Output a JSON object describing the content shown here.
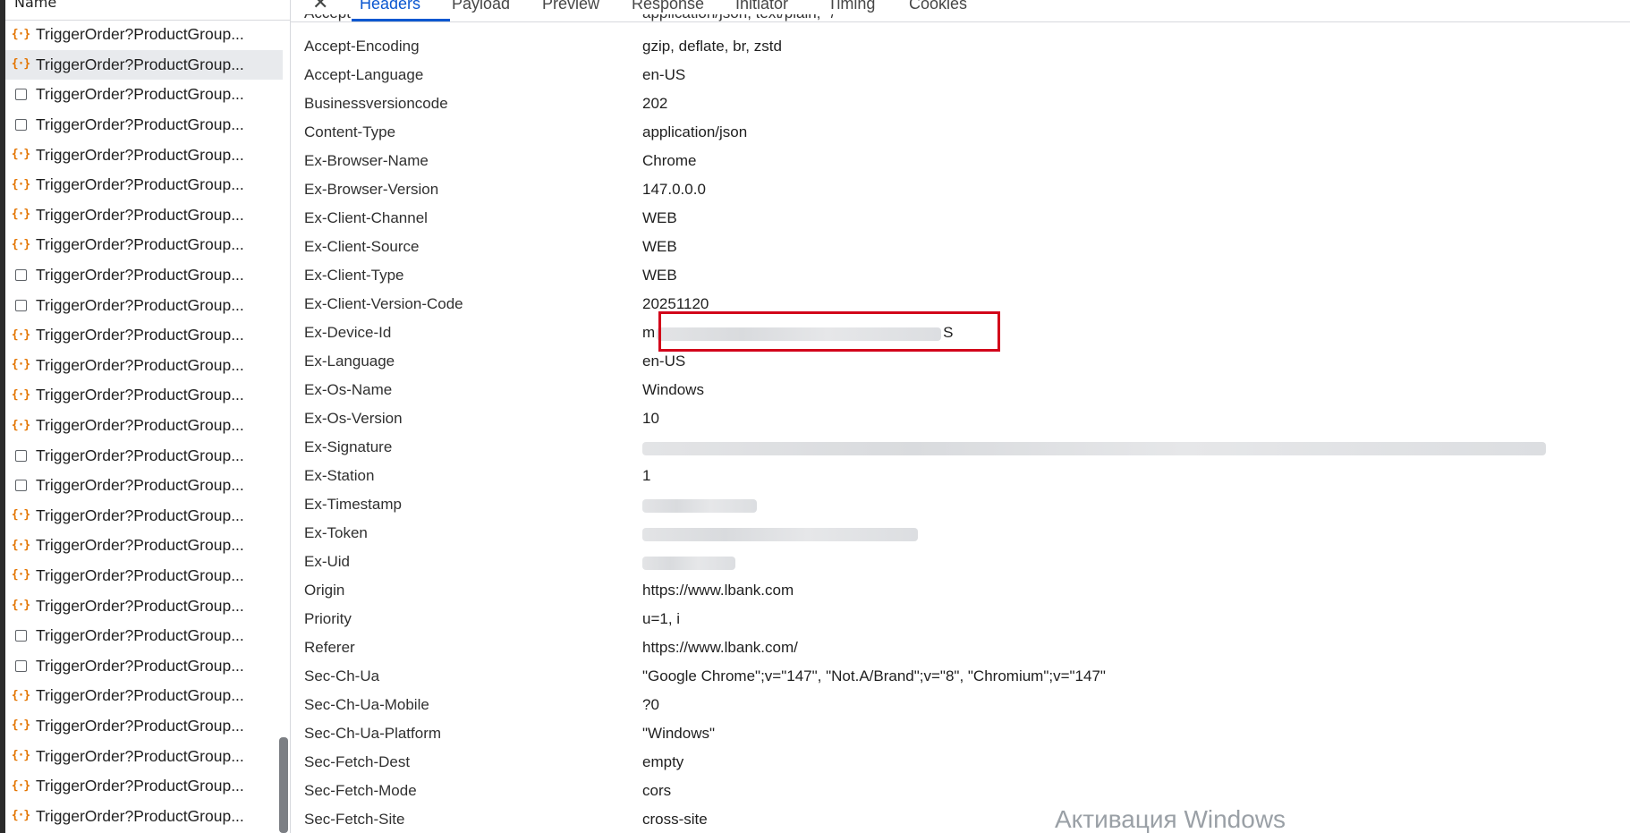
{
  "request_list": {
    "column_name": "Name",
    "rows": [
      {
        "label": "TriggerOrder?ProductGroup...",
        "icon": "xhr-braces-icon",
        "selected": false
      },
      {
        "label": "TriggerOrder?ProductGroup...",
        "icon": "xhr-braces-icon",
        "selected": true
      },
      {
        "label": "TriggerOrder?ProductGroup...",
        "icon": "document-icon",
        "selected": false
      },
      {
        "label": "TriggerOrder?ProductGroup...",
        "icon": "document-icon",
        "selected": false
      },
      {
        "label": "TriggerOrder?ProductGroup...",
        "icon": "xhr-braces-icon",
        "selected": false
      },
      {
        "label": "TriggerOrder?ProductGroup...",
        "icon": "xhr-braces-icon",
        "selected": false
      },
      {
        "label": "TriggerOrder?ProductGroup...",
        "icon": "xhr-braces-icon",
        "selected": false
      },
      {
        "label": "TriggerOrder?ProductGroup...",
        "icon": "xhr-braces-icon",
        "selected": false
      },
      {
        "label": "TriggerOrder?ProductGroup...",
        "icon": "document-icon",
        "selected": false
      },
      {
        "label": "TriggerOrder?ProductGroup...",
        "icon": "document-icon",
        "selected": false
      },
      {
        "label": "TriggerOrder?ProductGroup...",
        "icon": "xhr-braces-icon",
        "selected": false
      },
      {
        "label": "TriggerOrder?ProductGroup...",
        "icon": "xhr-braces-icon",
        "selected": false
      },
      {
        "label": "TriggerOrder?ProductGroup...",
        "icon": "xhr-braces-icon",
        "selected": false
      },
      {
        "label": "TriggerOrder?ProductGroup...",
        "icon": "xhr-braces-icon",
        "selected": false
      },
      {
        "label": "TriggerOrder?ProductGroup...",
        "icon": "document-icon",
        "selected": false
      },
      {
        "label": "TriggerOrder?ProductGroup...",
        "icon": "document-icon",
        "selected": false
      },
      {
        "label": "TriggerOrder?ProductGroup...",
        "icon": "xhr-braces-icon",
        "selected": false
      },
      {
        "label": "TriggerOrder?ProductGroup...",
        "icon": "xhr-braces-icon",
        "selected": false
      },
      {
        "label": "TriggerOrder?ProductGroup...",
        "icon": "xhr-braces-icon",
        "selected": false
      },
      {
        "label": "TriggerOrder?ProductGroup...",
        "icon": "xhr-braces-icon",
        "selected": false
      },
      {
        "label": "TriggerOrder?ProductGroup...",
        "icon": "document-icon",
        "selected": false
      },
      {
        "label": "TriggerOrder?ProductGroup...",
        "icon": "document-icon",
        "selected": false
      },
      {
        "label": "TriggerOrder?ProductGroup...",
        "icon": "xhr-braces-icon",
        "selected": false
      },
      {
        "label": "TriggerOrder?ProductGroup...",
        "icon": "xhr-braces-icon",
        "selected": false
      },
      {
        "label": "TriggerOrder?ProductGroup...",
        "icon": "xhr-braces-icon",
        "selected": false
      },
      {
        "label": "TriggerOrder?ProductGroup...",
        "icon": "xhr-braces-icon",
        "selected": false
      },
      {
        "label": "TriggerOrder?ProductGroup...",
        "icon": "xhr-braces-icon",
        "selected": false
      }
    ]
  },
  "tabs": {
    "close_label": "✕",
    "items": [
      {
        "label": "Headers",
        "active": true
      },
      {
        "label": "Payload",
        "active": false
      },
      {
        "label": "Preview",
        "active": false
      },
      {
        "label": "Response",
        "active": false
      },
      {
        "label": "Initiator",
        "active": false
      },
      {
        "label": "Timing",
        "active": false
      },
      {
        "label": "Cookies",
        "active": false
      }
    ]
  },
  "headers": {
    "clipped_top": {
      "name": "Accept",
      "value": "application/json, text/plain, */*"
    },
    "rows": [
      {
        "name": "Accept-Encoding",
        "value": "gzip, deflate, br, zstd"
      },
      {
        "name": "Accept-Language",
        "value": "en-US"
      },
      {
        "name": "Businessversioncode",
        "value": "202"
      },
      {
        "name": "Content-Type",
        "value": "application/json"
      },
      {
        "name": "Ex-Browser-Name",
        "value": "Chrome"
      },
      {
        "name": "Ex-Browser-Version",
        "value": "147.0.0.0"
      },
      {
        "name": "Ex-Client-Channel",
        "value": "WEB"
      },
      {
        "name": "Ex-Client-Source",
        "value": "WEB"
      },
      {
        "name": "Ex-Client-Type",
        "value": "WEB"
      },
      {
        "name": "Ex-Client-Version-Code",
        "value": "20251120"
      },
      {
        "name": "Ex-Device-Id",
        "value_prefix": "m",
        "value_suffix": "S",
        "redacted": true
      },
      {
        "name": "Ex-Language",
        "value": "en-US"
      },
      {
        "name": "Ex-Os-Name",
        "value": "Windows"
      },
      {
        "name": "Ex-Os-Version",
        "value": "10"
      },
      {
        "name": "Ex-Signature",
        "redacted": true
      },
      {
        "name": "Ex-Station",
        "value": "1"
      },
      {
        "name": "Ex-Timestamp",
        "redacted": true
      },
      {
        "name": "Ex-Token",
        "redacted": true
      },
      {
        "name": "Ex-Uid",
        "redacted": true
      },
      {
        "name": "Origin",
        "value": "https://www.lbank.com"
      },
      {
        "name": "Priority",
        "value": "u=1, i"
      },
      {
        "name": "Referer",
        "value": "https://www.lbank.com/"
      },
      {
        "name": "Sec-Ch-Ua",
        "value": "\"Google Chrome\";v=\"147\", \"Not.A/Brand\";v=\"8\", \"Chromium\";v=\"147\""
      },
      {
        "name": "Sec-Ch-Ua-Mobile",
        "value": "?0"
      },
      {
        "name": "Sec-Ch-Ua-Platform",
        "value": "\"Windows\""
      },
      {
        "name": "Sec-Fetch-Dest",
        "value": "empty"
      },
      {
        "name": "Sec-Fetch-Mode",
        "value": "cors"
      },
      {
        "name": "Sec-Fetch-Site",
        "value": "cross-site"
      }
    ]
  },
  "watermark": "Активация Windows",
  "colors": {
    "accent": "#0b57d0",
    "xhr_icon": "#e37400",
    "highlight_box": "#d2001a",
    "selected_row": "#e8eaed"
  }
}
